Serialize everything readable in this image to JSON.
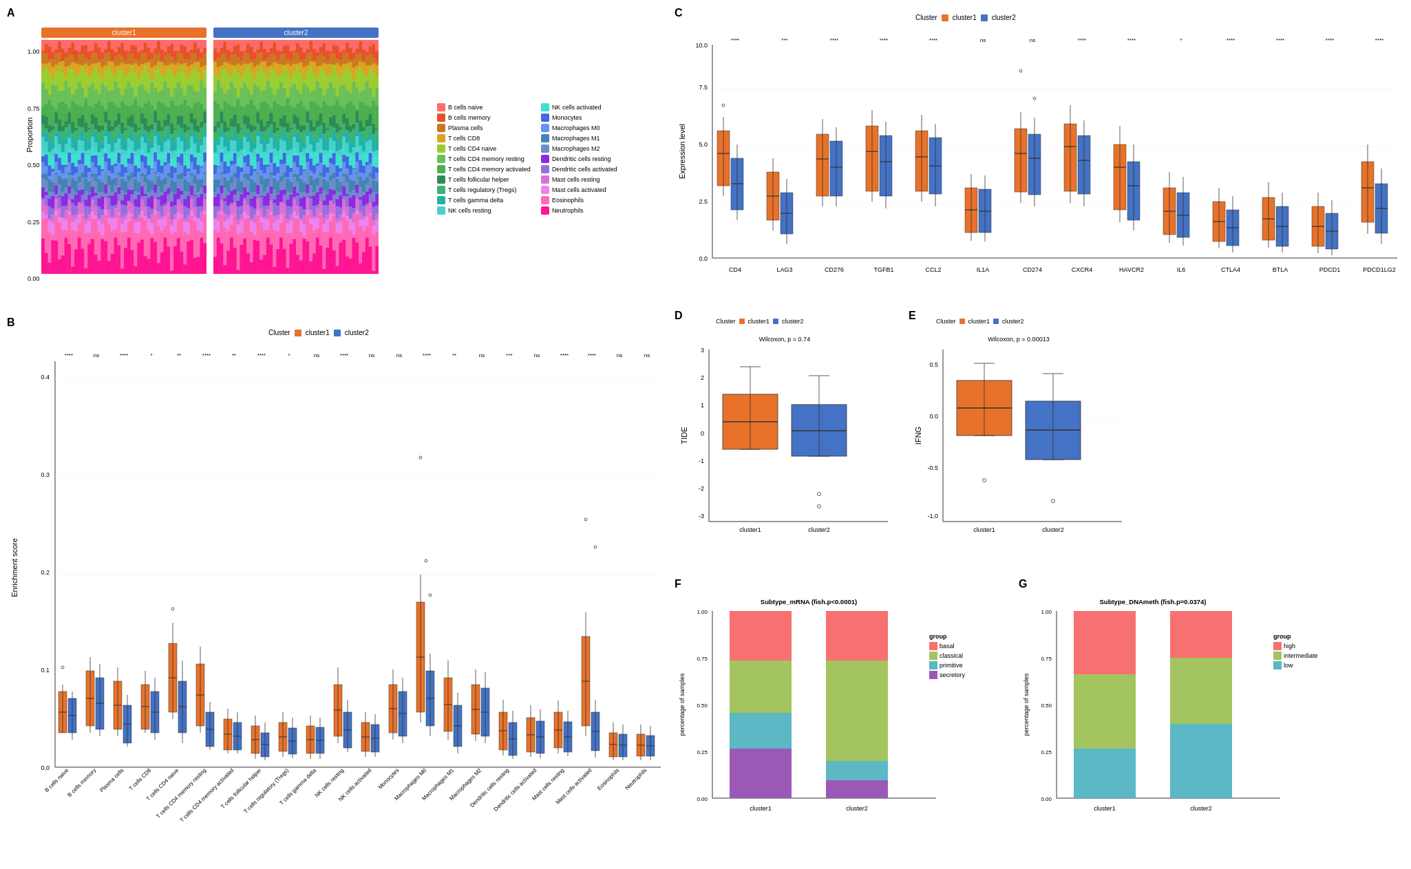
{
  "panels": {
    "a": {
      "label": "A",
      "cluster1_header": "cluster1",
      "cluster2_header": "cluster2",
      "y_axis_label": "Proportion",
      "y_ticks": [
        "1.00",
        "0.75",
        "0.50",
        "0.25",
        "0.00"
      ]
    },
    "b": {
      "label": "B",
      "title": "Cluster",
      "cluster1_label": "cluster1",
      "cluster2_label": "cluster2",
      "y_axis_label": "Enrichment score",
      "sig_labels": [
        "****",
        "ns",
        "****",
        "*",
        "**",
        "****",
        "**",
        "****",
        "*",
        "ns",
        "****",
        "ns",
        "ns",
        "****",
        "**",
        "ns",
        "***",
        "ns",
        "****",
        "****",
        "ns",
        "ns"
      ],
      "x_labels": [
        "B cells naive",
        "B cells memory",
        "Plasma cells",
        "T cells CD8",
        "T cells CD4 naive",
        "T cells CD4 memory resting",
        "T cells CD4 memory activated",
        "T cells follicular helper",
        "T cells regulatory (Tregs)",
        "T cells gamma delta",
        "NK cells resting",
        "NK cells activated",
        "Monocytes",
        "Macrophages M0",
        "Macrophages M1",
        "Macrophages M2",
        "Dendritic cells resting",
        "Dendritic cells activated",
        "Mast cells resting",
        "Mast cells activated",
        "Eosinophils",
        "Neutrophils"
      ],
      "y_ticks": [
        "0.0",
        "0.1",
        "0.2",
        "0.3",
        "0.4"
      ]
    },
    "c": {
      "label": "C",
      "title": "Cluster",
      "cluster1_label": "cluster1",
      "cluster2_label": "cluster2",
      "y_axis_label": "Expression level",
      "y_ticks": [
        "0.0",
        "2.5",
        "5.0",
        "7.5",
        "10.0"
      ],
      "x_labels": [
        "CD4",
        "LAG3",
        "CD276",
        "TGFB1",
        "CCL2",
        "IL1A",
        "CD274",
        "CXCR4",
        "HAVCR2",
        "IL6",
        "CTLA4",
        "BTLA",
        "PDCD1",
        "PDCD1LG2"
      ],
      "sig_labels": [
        "****",
        "***",
        "****",
        "****",
        "****",
        "ns",
        "ns",
        "****",
        "****",
        "*",
        "****",
        "****",
        "****",
        "****"
      ]
    },
    "d": {
      "label": "D",
      "title": "Wilcoxon, p = 0.74",
      "cluster_title": "Cluster",
      "cluster1_label": "cluster1",
      "cluster2_label": "cluster2",
      "y_axis_label": "TIDE",
      "y_ticks": [
        "3",
        "2",
        "1",
        "0",
        "-1",
        "-2",
        "-3"
      ]
    },
    "e": {
      "label": "E",
      "title": "Wilcoxon, p = 0.00013",
      "cluster_title": "Cluster",
      "cluster1_label": "cluster1",
      "cluster2_label": "cluster2",
      "y_axis_label": "IFNG",
      "y_ticks": [
        "0.5",
        "0.0",
        "-0.5",
        "-1.0"
      ]
    },
    "f": {
      "label": "F",
      "title": "Subtype_mRNA (fish.p<0.0001)",
      "y_axis_label": "percentage of samples",
      "x_labels": [
        "cluster1",
        "cluster2"
      ],
      "legend_title": "group",
      "legend_items": [
        "basal",
        "classical",
        "primitive",
        "secretory"
      ],
      "legend_colors": [
        "#F87171",
        "#A3C45E",
        "#5BB8C4",
        "#9B59B6"
      ]
    },
    "g": {
      "label": "G",
      "title": "Subtype_DNAmeth (fish.p=0.0374)",
      "y_axis_label": "percentage of samples",
      "x_labels": [
        "cluster1",
        "cluster2"
      ],
      "legend_title": "group",
      "legend_items": [
        "high",
        "intermediate",
        "low"
      ],
      "legend_colors": [
        "#F87171",
        "#A3C45E",
        "#5BB8C4"
      ]
    }
  },
  "legend_a": {
    "col1": [
      {
        "label": "B cells naive",
        "color": "#FF6B6B"
      },
      {
        "label": "B cells memory",
        "color": "#E8502A"
      },
      {
        "label": "Plasma cells",
        "color": "#CC7722"
      },
      {
        "label": "T cells CD8",
        "color": "#DAA520"
      },
      {
        "label": "T cells CD4 naive",
        "color": "#9ACD32"
      },
      {
        "label": "T cells CD4 memory resting",
        "color": "#6BBF59"
      },
      {
        "label": "T cells CD4 memory activated",
        "color": "#4CAF50"
      },
      {
        "label": "T cells follicular helper",
        "color": "#2E8B57"
      },
      {
        "label": "T cells regulatory (Tregs)",
        "color": "#3CB371"
      },
      {
        "label": "T cells gamma delta",
        "color": "#20B2AA"
      },
      {
        "label": "NK cells resting",
        "color": "#48D1CC"
      }
    ],
    "col2": [
      {
        "label": "NK cells activated",
        "color": "#40E0D0"
      },
      {
        "label": "Monocytes",
        "color": "#4169E1"
      },
      {
        "label": "Macrophages M0",
        "color": "#6495ED"
      },
      {
        "label": "Macrophages M1",
        "color": "#4682B4"
      },
      {
        "label": "Macrophages M2",
        "color": "#6B8EC8"
      },
      {
        "label": "Dendritic cells resting",
        "color": "#8A2BE2"
      },
      {
        "label": "Dendritic cells activated",
        "color": "#9370DB"
      },
      {
        "label": "Mast cells resting",
        "color": "#DA70D6"
      },
      {
        "label": "Mast cells activated",
        "color": "#EE82EE"
      },
      {
        "label": "Eosinophils",
        "color": "#FF69B4"
      },
      {
        "label": "Neutrophils",
        "color": "#FF1493"
      }
    ]
  },
  "colors": {
    "cluster1": "#E8722A",
    "cluster2": "#4472C4",
    "orange": "#E8722A",
    "blue": "#4472C4"
  }
}
